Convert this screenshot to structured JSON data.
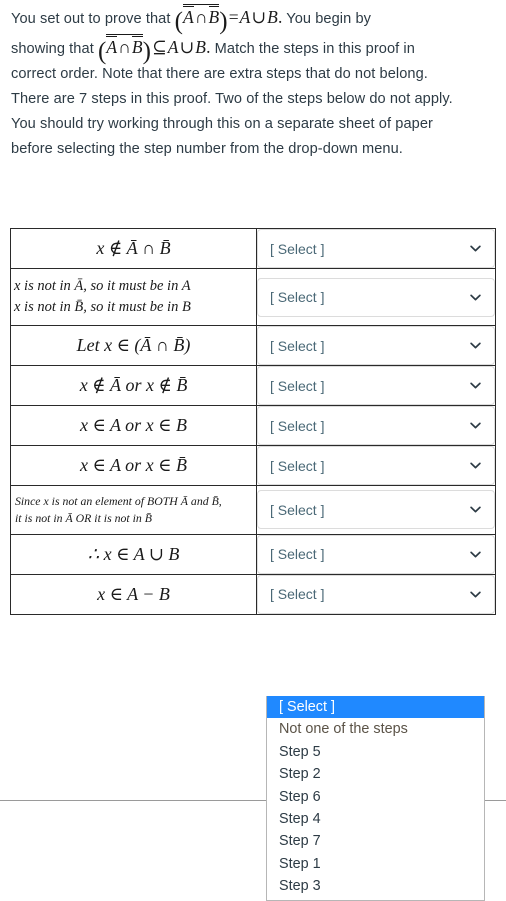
{
  "prompt": {
    "l1a": "You set out to prove that",
    "l1b": "You begin by",
    "l2a": "showing that",
    "l2b": "Match the steps in this proof in",
    "l3": "correct order. Note that there are extra steps that do not belong.",
    "l4": "There are 7 steps in this proof. Two of the steps below do not apply.",
    "l5": "You should try working through this on a separate sheet of paper",
    "l6": "before selecting the step number from the drop-down menu.",
    "math": {
      "A": "A",
      "B": "B",
      "cap": "∩",
      "cup": "∪",
      "eq": "=",
      "subseteq": "⊆",
      "lparen": "(",
      "rparen": ")"
    }
  },
  "table": {
    "rows": [
      {
        "id": "row-1",
        "style": "big",
        "statement": "x ∉ Ā ∩ B̄",
        "select_value": "[ Select ]"
      },
      {
        "id": "row-2",
        "style": "two",
        "statement_line1": "x is not in Ā, so it must be in A",
        "statement_line2": "x is not in B̄, so it must be in B",
        "select_value": "[ Select ]"
      },
      {
        "id": "row-3",
        "style": "big",
        "statement": "Let x ∈ (Ā ∩ B̄)",
        "select_value": "[ Select ]"
      },
      {
        "id": "row-4",
        "style": "big",
        "statement": "x ∉ Ā or x ∉ B̄",
        "select_value": "[ Select ]"
      },
      {
        "id": "row-5",
        "style": "big",
        "statement": "x ∈ A or x ∈ B",
        "select_value": "[ Select ]"
      },
      {
        "id": "row-6",
        "style": "big",
        "statement": "x ∈ A or x ∈ B̄",
        "select_value": "[ Select ]"
      },
      {
        "id": "row-7",
        "style": "small",
        "statement_line1": "Since x is not an element of BOTH Ā and B̄,",
        "statement_line2": "it is not in Ā OR it is not in B̄",
        "select_value": "[ Select ]"
      },
      {
        "id": "row-8",
        "style": "big",
        "statement": "∴ x ∈ A ∪ B",
        "select_value": "[ Select ]"
      },
      {
        "id": "row-9",
        "style": "big",
        "statement": "x ∈ A − B",
        "select_value": "[ Select ]"
      }
    ]
  },
  "dropdown": {
    "open_for_row": "row-9",
    "highlight_color": "#2089ff",
    "options": [
      "[ Select ]",
      "Not one of the steps",
      "Step 5",
      "Step 2",
      "Step 6",
      "Step 4",
      "Step 7",
      "Step 1",
      "Step 3"
    ],
    "selected_index": 0
  }
}
